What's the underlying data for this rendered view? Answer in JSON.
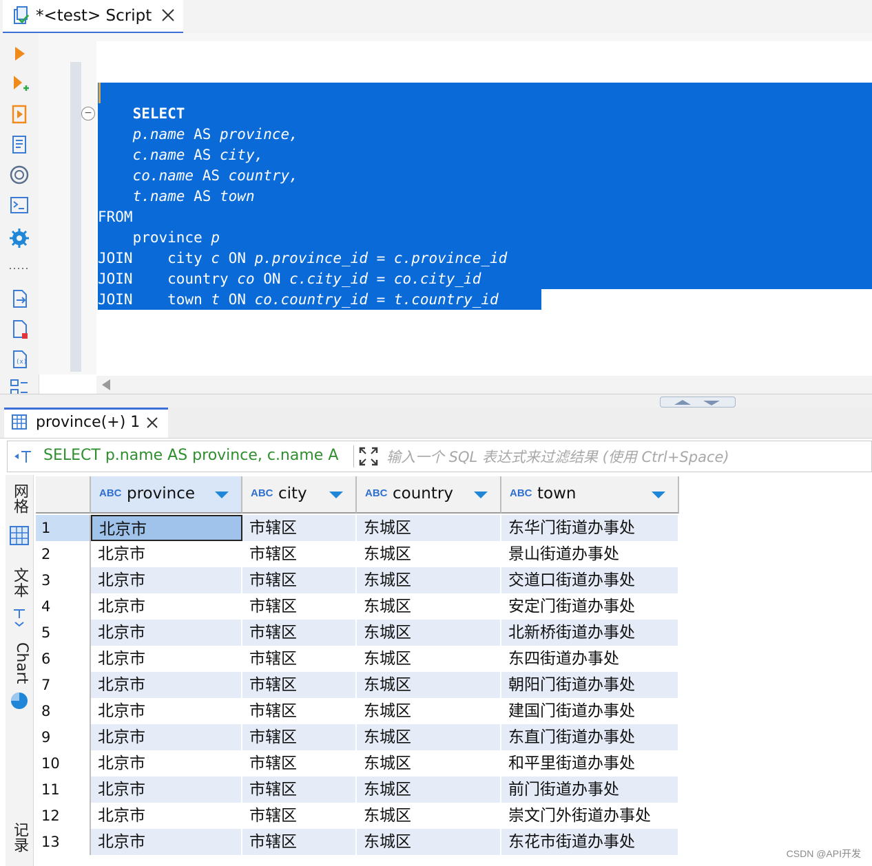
{
  "editor_tab": {
    "title": "*<test> Script"
  },
  "toolbar": {
    "icons": [
      "play-icon",
      "play-plus-icon",
      "run-script-icon",
      "explain-plan-icon",
      "ai-assistant-icon",
      "terminal-icon",
      "settings-gear-icon",
      "more-dots-icon",
      "export-icon",
      "new-file-icon",
      "variables-icon",
      "outline-icon"
    ]
  },
  "sql": {
    "lines": [
      [
        {
          "t": "    SELECT",
          "c": "kw"
        }
      ],
      [
        {
          "t": "    p.name ",
          "c": "it"
        },
        {
          "t": "AS ",
          "c": ""
        },
        {
          "t": "province,",
          "c": "it"
        }
      ],
      [
        {
          "t": "    c.name ",
          "c": "it"
        },
        {
          "t": "AS ",
          "c": ""
        },
        {
          "t": "city,",
          "c": "it"
        }
      ],
      [
        {
          "t": "    co.name ",
          "c": "it"
        },
        {
          "t": "AS ",
          "c": ""
        },
        {
          "t": "country,",
          "c": "it"
        }
      ],
      [
        {
          "t": "    t.name ",
          "c": "it"
        },
        {
          "t": "AS ",
          "c": ""
        },
        {
          "t": "town",
          "c": "it"
        }
      ],
      [
        {
          "t": "FROM",
          "c": ""
        }
      ],
      [
        {
          "t": "    province ",
          "c": ""
        },
        {
          "t": "p",
          "c": "it"
        }
      ],
      [
        {
          "t": "JOIN    city ",
          "c": ""
        },
        {
          "t": "c ",
          "c": "it"
        },
        {
          "t": "ON ",
          "c": ""
        },
        {
          "t": "p.province_id ",
          "c": "it"
        },
        {
          "t": "= ",
          "c": ""
        },
        {
          "t": "c.province_id",
          "c": "it"
        }
      ],
      [
        {
          "t": "JOIN    country ",
          "c": ""
        },
        {
          "t": "co ",
          "c": "it"
        },
        {
          "t": "ON ",
          "c": ""
        },
        {
          "t": "c.city_id ",
          "c": "it"
        },
        {
          "t": "= ",
          "c": ""
        },
        {
          "t": "co.city_id",
          "c": "it"
        }
      ],
      [
        {
          "t": "JOIN    town ",
          "c": ""
        },
        {
          "t": "t ",
          "c": "it"
        },
        {
          "t": "ON ",
          "c": ""
        },
        {
          "t": "co.country_id ",
          "c": "it"
        },
        {
          "t": "= ",
          "c": ""
        },
        {
          "t": "t.country_id",
          "c": "it"
        }
      ]
    ]
  },
  "result_tab": {
    "title": "province(+) 1"
  },
  "filter": {
    "sql_preview": "SELECT p.name AS province, c.name A",
    "placeholder": "输入一个 SQL 表达式来过滤结果 (使用 Ctrl+Space)"
  },
  "side_tabs": {
    "grid": "网格",
    "text": "文本",
    "chart": "Chart",
    "record": "记录"
  },
  "grid": {
    "type_badge": "ABC",
    "columns": [
      "province",
      "city",
      "country",
      "town"
    ],
    "rows": [
      [
        "1",
        "北京市",
        "市辖区",
        "东城区",
        "东华门街道办事处"
      ],
      [
        "2",
        "北京市",
        "市辖区",
        "东城区",
        "景山街道办事处"
      ],
      [
        "3",
        "北京市",
        "市辖区",
        "东城区",
        "交道口街道办事处"
      ],
      [
        "4",
        "北京市",
        "市辖区",
        "东城区",
        "安定门街道办事处"
      ],
      [
        "5",
        "北京市",
        "市辖区",
        "东城区",
        "北新桥街道办事处"
      ],
      [
        "6",
        "北京市",
        "市辖区",
        "东城区",
        "东四街道办事处"
      ],
      [
        "7",
        "北京市",
        "市辖区",
        "东城区",
        "朝阳门街道办事处"
      ],
      [
        "8",
        "北京市",
        "市辖区",
        "东城区",
        "建国门街道办事处"
      ],
      [
        "9",
        "北京市",
        "市辖区",
        "东城区",
        "东直门街道办事处"
      ],
      [
        "10",
        "北京市",
        "市辖区",
        "东城区",
        "和平里街道办事处"
      ],
      [
        "11",
        "北京市",
        "市辖区",
        "东城区",
        "前门街道办事处"
      ],
      [
        "12",
        "北京市",
        "市辖区",
        "东城区",
        "崇文门外街道办事处"
      ],
      [
        "13",
        "北京市",
        "市辖区",
        "东城区",
        "东花市街道办事处"
      ]
    ]
  },
  "colors": {
    "selection": "#0a6ad8",
    "row_stripe": "#e5ecf7",
    "accent": "#1f86d8"
  },
  "watermark": "CSDN @API开发"
}
